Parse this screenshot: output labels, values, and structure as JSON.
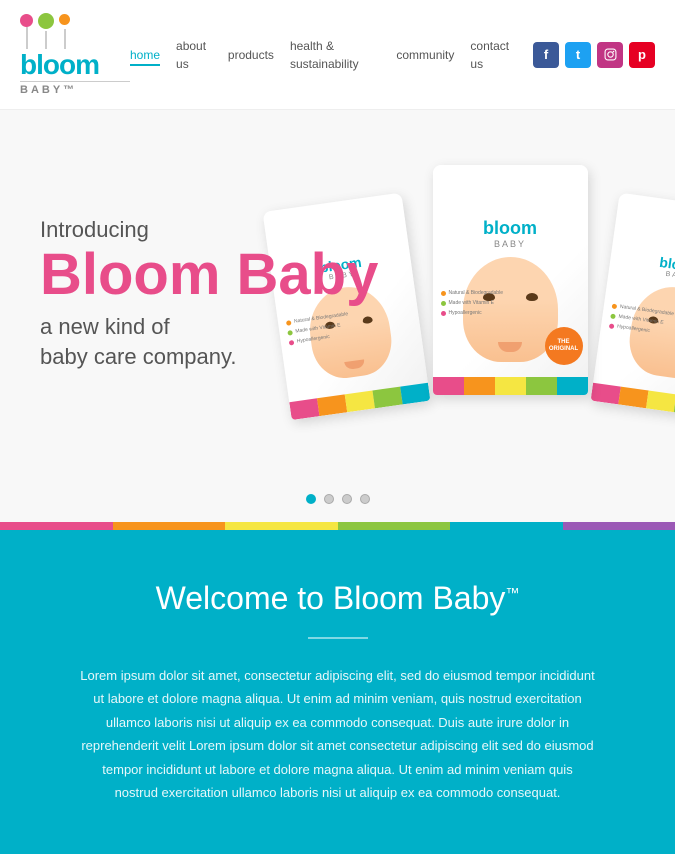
{
  "header": {
    "logo_name": "bloom",
    "logo_sub": "BABY™",
    "nav": {
      "items": [
        {
          "label": "home",
          "active": true
        },
        {
          "label": "about us",
          "active": false
        },
        {
          "label": "products",
          "active": false
        },
        {
          "label": "health & sustainability",
          "active": false
        },
        {
          "label": "community",
          "active": false
        },
        {
          "label": "contact us",
          "active": false
        }
      ]
    },
    "social": {
      "facebook": "f",
      "twitter": "t",
      "instagram": "in",
      "pinterest": "p"
    }
  },
  "hero": {
    "introducing": "Introducing",
    "title": "Bloom Baby",
    "subtitle_line1": "a new kind of",
    "subtitle_line2": "baby care company."
  },
  "pagination": {
    "dots": 4,
    "active": 0
  },
  "color_bar": {
    "colors": [
      "#e84d8a",
      "#f7941d",
      "#f5e642",
      "#8cc63f",
      "#00b0c8",
      "#9b59b6"
    ]
  },
  "welcome": {
    "title": "Welcome to Bloom Baby",
    "trademark": "™",
    "body": "Lorem ipsum dolor sit amet, consectetur adipiscing elit, sed do eiusmod tempor incididunt ut labore et dolore magna aliqua. Ut enim ad minim veniam, quis nostrud exercitation ullamco laboris nisi ut aliquip ex ea commodo consequat. Duis aute irure dolor in reprehenderit velit Lorem ipsum dolor sit amet consectetur adipiscing elit sed do eiusmod tempor incididunt ut labore et dolore magna aliqua. Ut enim ad minim veniam quis nostrud exercitation ullamco laboris nisi ut aliquip ex ea commodo consequat."
  },
  "packages": {
    "badge_text": "THE ORIGINAL",
    "dots": [
      {
        "color": "#f7941d"
      },
      {
        "color": "#8cc63f"
      },
      {
        "color": "#e84d8a"
      },
      {
        "color": "#00b0c8"
      }
    ]
  }
}
